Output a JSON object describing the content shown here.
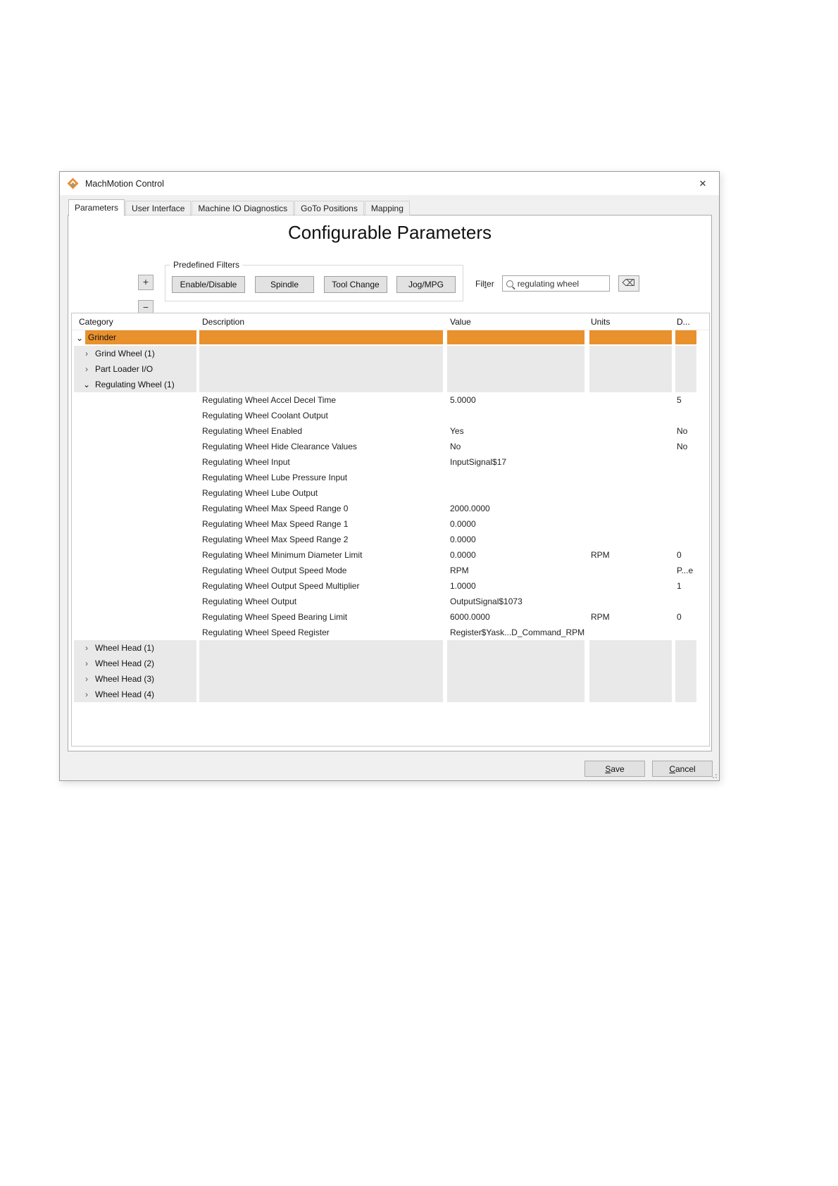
{
  "window": {
    "title": "MachMotion Control"
  },
  "icons": {
    "close": "✕",
    "expand_all": "+",
    "collapse_all": "−",
    "clear": "⌫",
    "chevron_down": "⌄",
    "chevron_right": "›"
  },
  "tabs": [
    {
      "label": "Parameters",
      "active": true
    },
    {
      "label": "User Interface",
      "active": false
    },
    {
      "label": "Machine IO Diagnostics",
      "active": false
    },
    {
      "label": "GoTo Positions",
      "active": false
    },
    {
      "label": "Mapping",
      "active": false
    }
  ],
  "page": {
    "title": "Configurable Parameters"
  },
  "toolbar": {
    "group_label": "Predefined Filters",
    "filter_buttons": [
      "Enable/Disable",
      "Spindle",
      "Tool Change",
      "Jog/MPG"
    ],
    "filter_label_pre": "Fil",
    "filter_label_mnemonic": "t",
    "filter_label_post": "er",
    "search_value": "regulating wheel"
  },
  "grid": {
    "headers": [
      "Category",
      "Description",
      "Value",
      "Units",
      "D..."
    ],
    "tree_top": [
      {
        "label": "Grinder",
        "state": "expanded",
        "selected": true,
        "level": 0
      },
      {
        "label": "Grind Wheel (1)",
        "state": "collapsed",
        "selected": false,
        "level": 1
      },
      {
        "label": "Part Loader I/O",
        "state": "collapsed",
        "selected": false,
        "level": 1
      },
      {
        "label": "Regulating Wheel (1)",
        "state": "expanded",
        "selected": false,
        "level": 1
      }
    ],
    "parameters": [
      {
        "description": "Regulating Wheel Accel Decel Time",
        "value": "5.0000",
        "units": "",
        "default": "5"
      },
      {
        "description": "Regulating Wheel Coolant Output",
        "value": "",
        "units": "",
        "default": ""
      },
      {
        "description": "Regulating Wheel Enabled",
        "value": "Yes",
        "units": "",
        "default": "No"
      },
      {
        "description": "Regulating Wheel Hide Clearance Values",
        "value": "No",
        "units": "",
        "default": "No"
      },
      {
        "description": "Regulating Wheel Input",
        "value": "InputSignal$17",
        "units": "",
        "default": ""
      },
      {
        "description": "Regulating Wheel Lube Pressure Input",
        "value": "",
        "units": "",
        "default": ""
      },
      {
        "description": "Regulating Wheel Lube Output",
        "value": "",
        "units": "",
        "default": ""
      },
      {
        "description": "Regulating Wheel Max Speed Range 0",
        "value": "2000.0000",
        "units": "",
        "default": ""
      },
      {
        "description": "Regulating Wheel Max Speed Range 1",
        "value": "0.0000",
        "units": "",
        "default": ""
      },
      {
        "description": "Regulating Wheel Max Speed Range 2",
        "value": "0.0000",
        "units": "",
        "default": ""
      },
      {
        "description": "Regulating Wheel Minimum Diameter Limit",
        "value": "0.0000",
        "units": "RPM",
        "default": "0"
      },
      {
        "description": "Regulating Wheel Output Speed Mode",
        "value": "RPM",
        "units": "",
        "default": "P...e"
      },
      {
        "description": "Regulating Wheel Output Speed Multiplier",
        "value": "1.0000",
        "units": "",
        "default": "1"
      },
      {
        "description": "Regulating Wheel Output",
        "value": "OutputSignal$1073",
        "units": "",
        "default": ""
      },
      {
        "description": "Regulating Wheel Speed Bearing Limit",
        "value": "6000.0000",
        "units": "RPM",
        "default": "0"
      },
      {
        "description": "Regulating Wheel Speed Register",
        "value": "Register$Yask...D_Command_RPM",
        "units": "",
        "default": ""
      }
    ],
    "tree_bottom": [
      {
        "label": "Wheel Head (1)",
        "state": "collapsed",
        "selected": false,
        "level": 1
      },
      {
        "label": "Wheel Head (2)",
        "state": "collapsed",
        "selected": false,
        "level": 1
      },
      {
        "label": "Wheel Head (3)",
        "state": "collapsed",
        "selected": false,
        "level": 1
      },
      {
        "label": "Wheel Head (4)",
        "state": "collapsed",
        "selected": false,
        "level": 1
      }
    ]
  },
  "footer": {
    "save_mnemonic": "S",
    "save_rest": "ave",
    "cancel_mnemonic": "C",
    "cancel_rest": "ancel"
  },
  "colors": {
    "accent": "#e8912d",
    "cell_gray": "#e9e9e9"
  }
}
